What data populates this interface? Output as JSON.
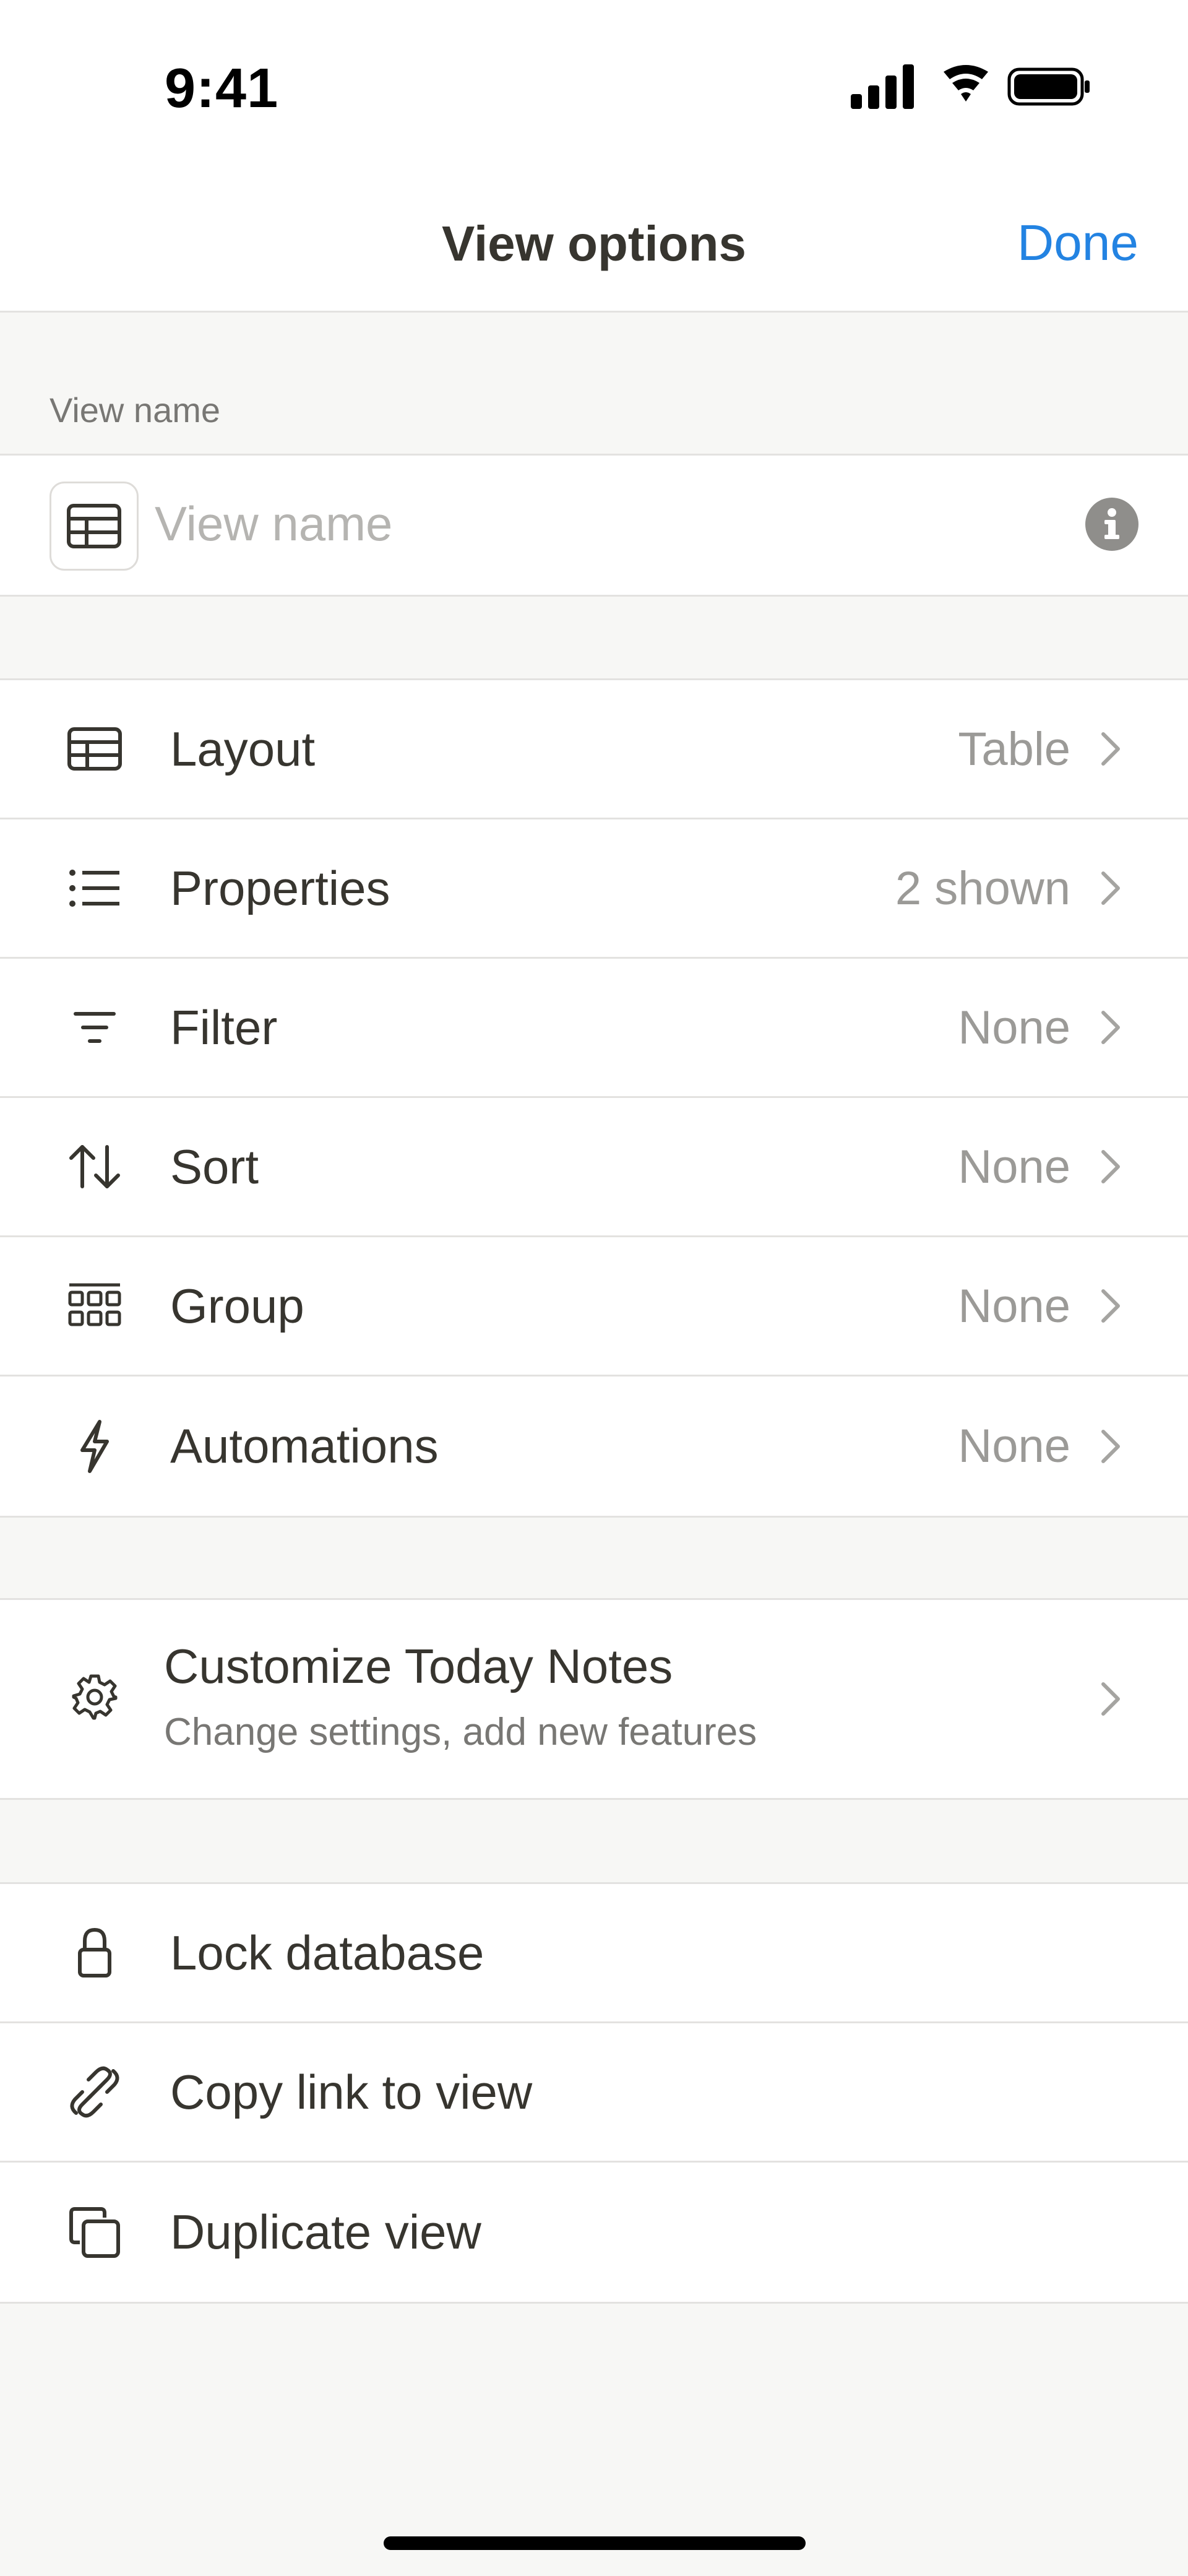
{
  "status_bar": {
    "time": "9:41"
  },
  "nav": {
    "title": "View options",
    "done_label": "Done"
  },
  "view_name": {
    "section_label": "View name",
    "placeholder": "View name",
    "value": ""
  },
  "settings": [
    {
      "label": "Layout",
      "value": "Table",
      "icon": "table-icon"
    },
    {
      "label": "Properties",
      "value": "2 shown",
      "icon": "list-icon"
    },
    {
      "label": "Filter",
      "value": "None",
      "icon": "filter-icon"
    },
    {
      "label": "Sort",
      "value": "None",
      "icon": "sort-icon"
    },
    {
      "label": "Group",
      "value": "None",
      "icon": "group-icon"
    },
    {
      "label": "Automations",
      "value": "None",
      "icon": "lightning-icon"
    }
  ],
  "customize": {
    "title": "Customize Today Notes",
    "subtitle": "Change settings, add new features",
    "icon": "gear-icon"
  },
  "actions": [
    {
      "label": "Lock database",
      "icon": "lock-icon"
    },
    {
      "label": "Copy link to view",
      "icon": "link-icon"
    },
    {
      "label": "Duplicate view",
      "icon": "duplicate-icon"
    }
  ],
  "colors": {
    "accent": "#2383e2",
    "background": "#f7f7f5",
    "text": "#37352f",
    "muted": "#9b9a97"
  }
}
